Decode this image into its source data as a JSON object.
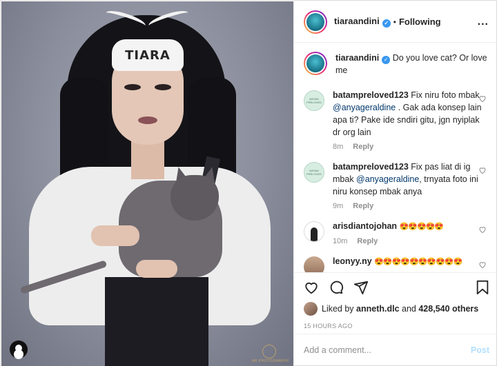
{
  "photo": {
    "headband_text": "TIARA",
    "watermark_text": "AR PHOTOGRAPHY"
  },
  "header": {
    "username": "tiaraandini",
    "separator": "•",
    "follow_status": "Following",
    "more_label": "..."
  },
  "caption": {
    "username": "tiaraandini",
    "text": "Do you love cat? Or love me"
  },
  "comments": [
    {
      "username": "batampreloved123",
      "text_before": "Fix niru foto mbak ",
      "mention": "@anyageraldine",
      "text_after": " . Gak ada konsep lain apa ti? Pake ide sndiri gitu, jgn nyiplak dr org lain",
      "time": "8m",
      "reply": "Reply",
      "avatar_text": "BATAM PRELOVED"
    },
    {
      "username": "batampreloved123",
      "text_before": "Fix pas liat di ig mbak ",
      "mention": "@anyageraldine",
      "text_after": ", trnyata foto ini niru konsep mbak anya",
      "time": "9m",
      "reply": "Reply",
      "avatar_text": "BATAM PRELOVED"
    },
    {
      "username": "arisdiantojohan",
      "emoji": "😍😍😍😍😍",
      "time": "10m",
      "reply": "Reply"
    },
    {
      "username": "leonyy.ny",
      "emoji": "😍😍😍😍😍😍😍😍😍😍"
    }
  ],
  "likes": {
    "prefix": "Liked by ",
    "liker": "anneth.dlc",
    "middle": " and ",
    "count": "428,540 others"
  },
  "timestamp": "15 HOURS AGO",
  "add_comment": {
    "placeholder": "Add a comment...",
    "post_label": "Post"
  },
  "colors": {
    "link": "#00376b",
    "verified": "#3897f0",
    "post_disabled": "#b2dffc",
    "muted": "#8e8e8e"
  },
  "icons": [
    "heart-icon",
    "comment-icon",
    "share-icon",
    "bookmark-icon",
    "verified-icon",
    "more-icon"
  ]
}
